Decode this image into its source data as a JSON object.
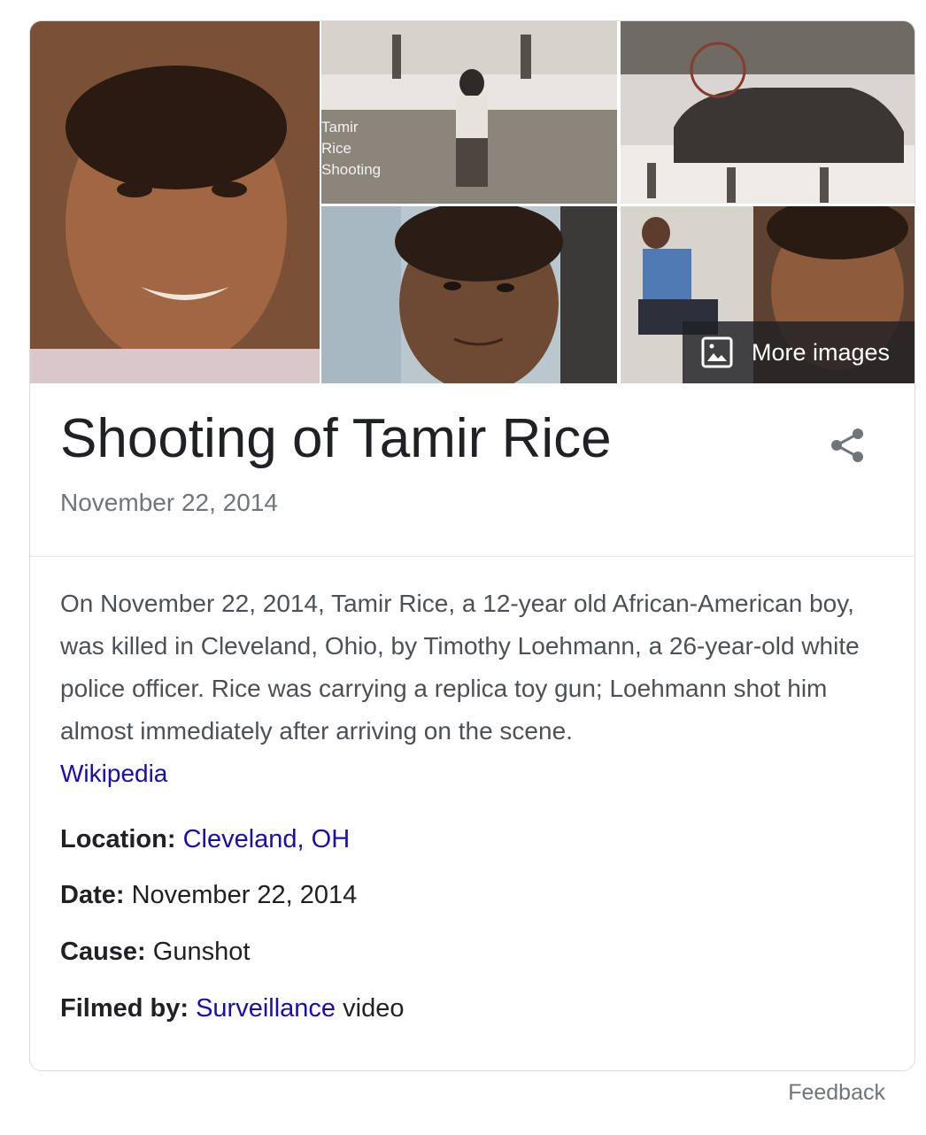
{
  "images": {
    "tiles": [
      {
        "name": "portrait-photo"
      },
      {
        "name": "surveillance-still",
        "caption": "Tamir\nRice\nShooting"
      },
      {
        "name": "police-car-still"
      },
      {
        "name": "smiling-photo"
      },
      {
        "name": "crouching-photo"
      }
    ],
    "more_label": "More images"
  },
  "header": {
    "title": "Shooting of Tamir Rice",
    "date": "November 22, 2014"
  },
  "description": {
    "text": "On November 22, 2014, Tamir Rice, a 12-year old African-American boy, was killed in Cleveland, Ohio, by Timothy Loehmann, a 26-year-old white police officer. Rice was carrying a replica toy gun; Loehmann shot him almost immediately after arriving on the scene.",
    "source_link": "Wikipedia"
  },
  "facts": [
    {
      "label": "Location:",
      "value_link": "Cleveland, OH",
      "value": ""
    },
    {
      "label": "Date:",
      "value_link": "",
      "value": "November 22, 2014"
    },
    {
      "label": "Cause:",
      "value_link": "",
      "value": "Gunshot"
    },
    {
      "label": "Filmed by:",
      "value_link": "Surveillance",
      "value": "video"
    }
  ],
  "footer": {
    "feedback": "Feedback"
  },
  "colors": {
    "link": "#1a0dab",
    "title": "#202124",
    "muted": "#70757a",
    "border": "#dadce0"
  }
}
